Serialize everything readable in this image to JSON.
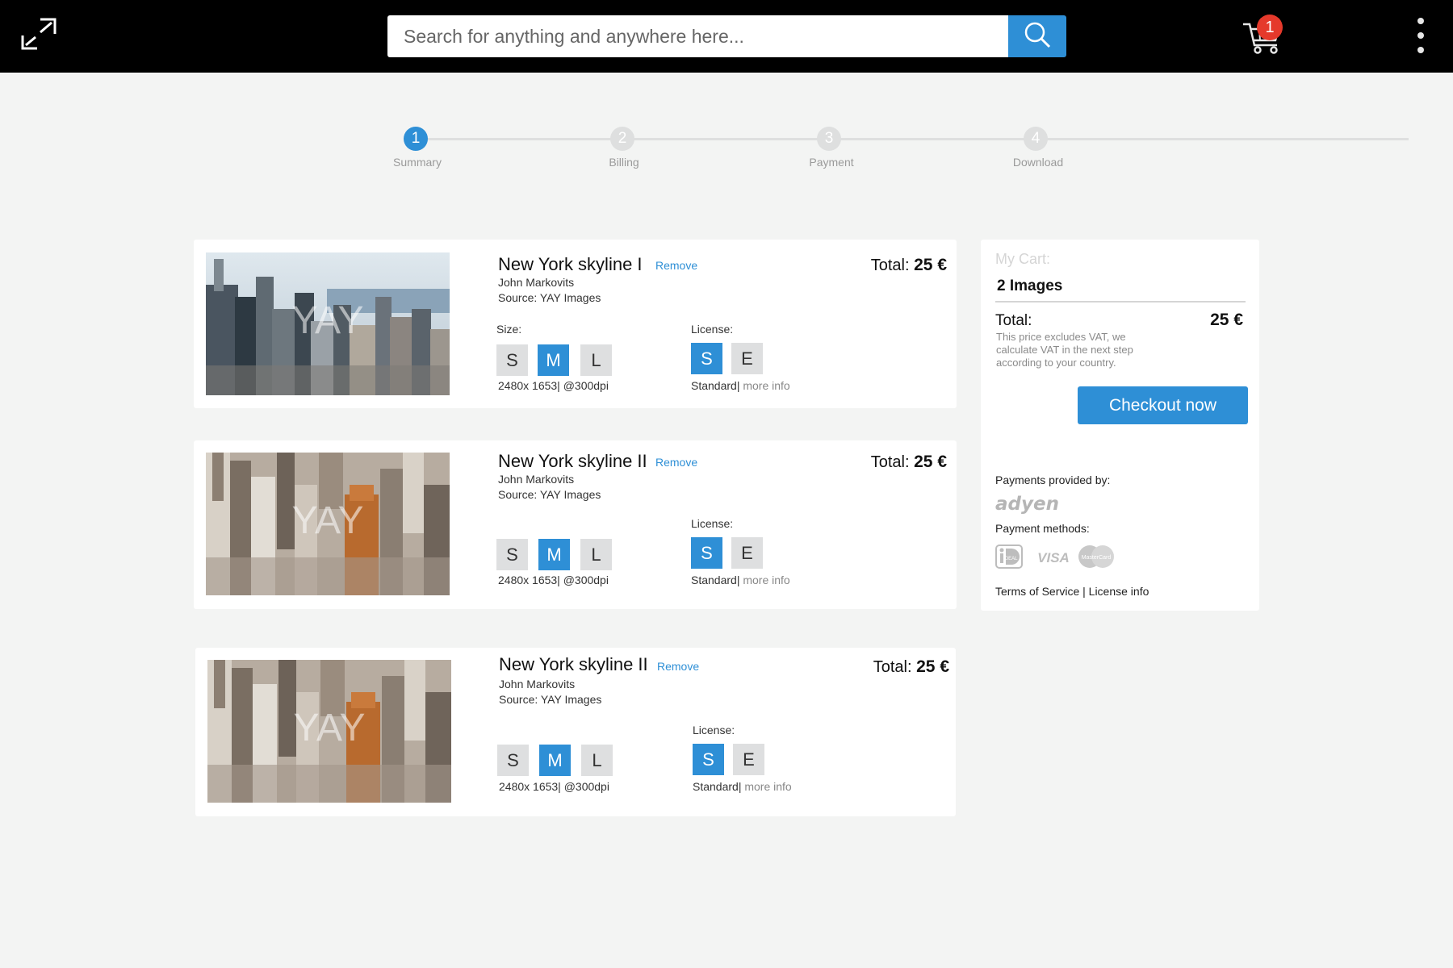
{
  "header": {
    "search_placeholder": "Search for anything and anywhere here...",
    "cart_count": "1"
  },
  "stepper": {
    "steps": [
      {
        "number": "1",
        "label": "Summary"
      },
      {
        "number": "2",
        "label": "Billing"
      },
      {
        "number": "3",
        "label": "Payment"
      },
      {
        "number": "4",
        "label": "Download"
      }
    ]
  },
  "cart_items": [
    {
      "title": "New York skyline I",
      "remove_label": "Remove",
      "author": "John Markovits",
      "source": "Source: YAY Images",
      "total_label": "Total:",
      "total_value": "25 €",
      "size_label": "Size:",
      "sizes": [
        "S",
        "M",
        "L"
      ],
      "resolution": "2480x 1653| @300dpi",
      "license_label": "License:",
      "licenses": [
        "S",
        "E"
      ],
      "license_name": "Standard|",
      "more_info": "more info",
      "watermark": "YAY"
    },
    {
      "title": "New York skyline II",
      "remove_label": "Remove",
      "author": "John Markovits",
      "source": "Source: YAY Images",
      "total_label": "Total:",
      "total_value": "25 €",
      "sizes": [
        "S",
        "M",
        "L"
      ],
      "resolution": "2480x 1653| @300dpi",
      "license_label": "License:",
      "licenses": [
        "S",
        "E"
      ],
      "license_name": "Standard|",
      "more_info": "more info",
      "watermark": "YAY"
    },
    {
      "title": "New York skyline II",
      "remove_label": "Remove",
      "author": "John Markovits",
      "source": "Source: YAY Images",
      "total_label": "Total:",
      "total_value": "25 €",
      "sizes": [
        "S",
        "M",
        "L"
      ],
      "resolution": "2480x 1653| @300dpi",
      "license_label": "License:",
      "licenses": [
        "S",
        "E"
      ],
      "license_name": "Standard|",
      "more_info": "more info",
      "watermark": "YAY"
    }
  ],
  "sidebar": {
    "heading": "My Cart:",
    "count": "2 Images",
    "total_label": "Total:",
    "total_value": "25 €",
    "vat_note": "This price excludes VAT, we calculate VAT in the next step according to your country.",
    "checkout_label": "Checkout now",
    "payments_provided": "Payments provided by:",
    "provider": "adyen",
    "payment_methods": "Payment methods:",
    "method_icons": [
      "ideal-icon",
      "visa-icon",
      "mastercard-icon"
    ],
    "method_labels": {
      "ideal": "iDEAL",
      "visa": "VISA",
      "mastercard": "MasterCard"
    },
    "terms": "Terms of Service | License info"
  },
  "colors": {
    "accent": "#2e8fd6",
    "badge": "#e5392b",
    "page_bg": "#f3f4f3",
    "topbar": "#000000",
    "inactive": "#dedfe0"
  }
}
